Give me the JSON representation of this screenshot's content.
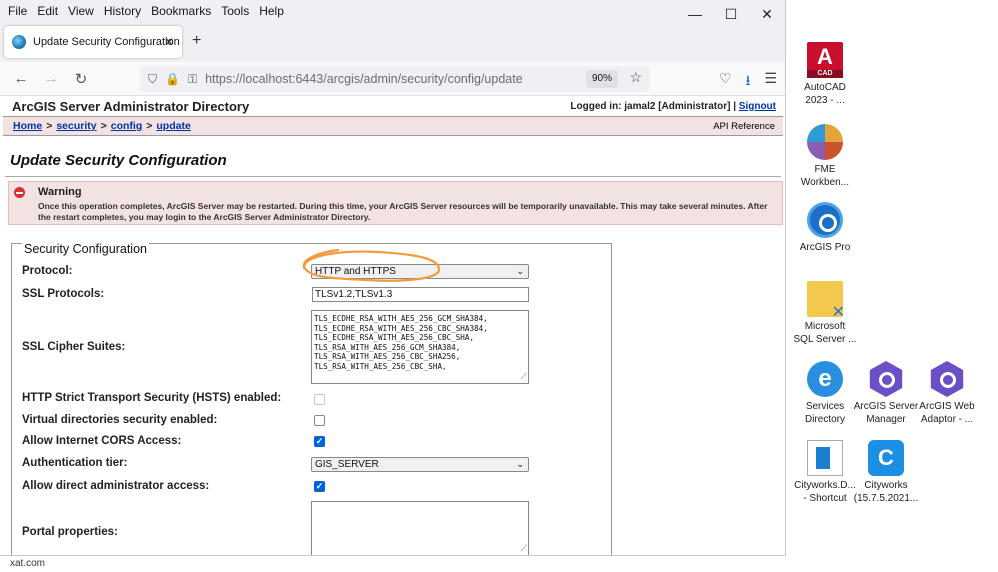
{
  "menubar": {
    "items": [
      "File",
      "Edit",
      "View",
      "History",
      "Bookmarks",
      "Tools",
      "Help"
    ]
  },
  "tab": {
    "title": "Update Security Configuration"
  },
  "address": {
    "host": "https://localhost",
    "path": ":6443/arcgis/admin/security/config/update",
    "zoom": "90%"
  },
  "header": {
    "site_title": "ArcGIS Server Administrator Directory",
    "logged_in": "Logged in: jamal2 [Administrator] |",
    "signout": "Signout"
  },
  "breadcrumb": {
    "home": "Home",
    "security": "security",
    "config": "config",
    "update": "update",
    "sep": ">",
    "api_reference": "API Reference"
  },
  "page_title": "Update Security Configuration",
  "warning": {
    "title": "Warning",
    "text": "Once this operation completes, ArcGIS Server may be restarted. During this time, your ArcGIS Server resources will be temporarily unavailable. This may take several minutes. After the restart completes, you may login to the ArcGIS Server Administrator Directory."
  },
  "form": {
    "legend": "Security Configuration",
    "protocol": {
      "label": "Protocol:",
      "value": "HTTP and HTTPS"
    },
    "ssl_protocols": {
      "label": "SSL Protocols:",
      "value": "TLSv1.2,TLSv1.3"
    },
    "cipher_suites": {
      "label": "SSL Cipher Suites:",
      "lines": [
        "TLS_ECDHE_RSA_WITH_AES_256_GCM_SHA384,",
        "TLS_ECDHE_RSA_WITH_AES_256_CBC_SHA384,",
        "TLS_ECDHE_RSA_WITH_AES_256_CBC_SHA,",
        "TLS_RSA_WITH_AES_256_GCM_SHA384,",
        "TLS_RSA_WITH_AES_256_CBC_SHA256,",
        "TLS_RSA_WITH_AES_256_CBC_SHA,"
      ]
    },
    "hsts": {
      "label": "HTTP Strict Transport Security (HSTS) enabled:",
      "checked": false,
      "disabled": true
    },
    "virtual_dirs": {
      "label": "Virtual directories security enabled:",
      "checked": false
    },
    "cors": {
      "label": "Allow Internet CORS Access:",
      "checked": true
    },
    "auth_tier": {
      "label": "Authentication tier:",
      "value": "GIS_SERVER"
    },
    "direct_admin": {
      "label": "Allow direct administrator access:",
      "checked": true
    },
    "portal_props": {
      "label": "Portal properties:"
    }
  },
  "status_bar": {
    "text": "xat.com"
  },
  "desktop": {
    "icons": [
      {
        "l1": "AutoCAD",
        "l2": "2023 - ..."
      },
      {
        "l1": "FME",
        "l2": "Workben..."
      },
      {
        "l1": "ArcGIS Pro",
        "l2": ""
      },
      {
        "l1": "Microsoft",
        "l2": "SQL Server ..."
      },
      {
        "l1": "Services",
        "l2": "Directory"
      },
      {
        "l1": "ArcGIS Server",
        "l2": "Manager"
      },
      {
        "l1": "ArcGIS Web",
        "l2": "Adaptor - ..."
      },
      {
        "l1": "Cityworks.D...",
        "l2": "- Shortcut"
      },
      {
        "l1": "Cityworks",
        "l2": "(15.7.5.2021..."
      }
    ]
  },
  "colors": {
    "accent_checkbox": "#0060df",
    "annotation": "#f39a3c",
    "breadcrumb_bg": "#f3e2e2"
  }
}
